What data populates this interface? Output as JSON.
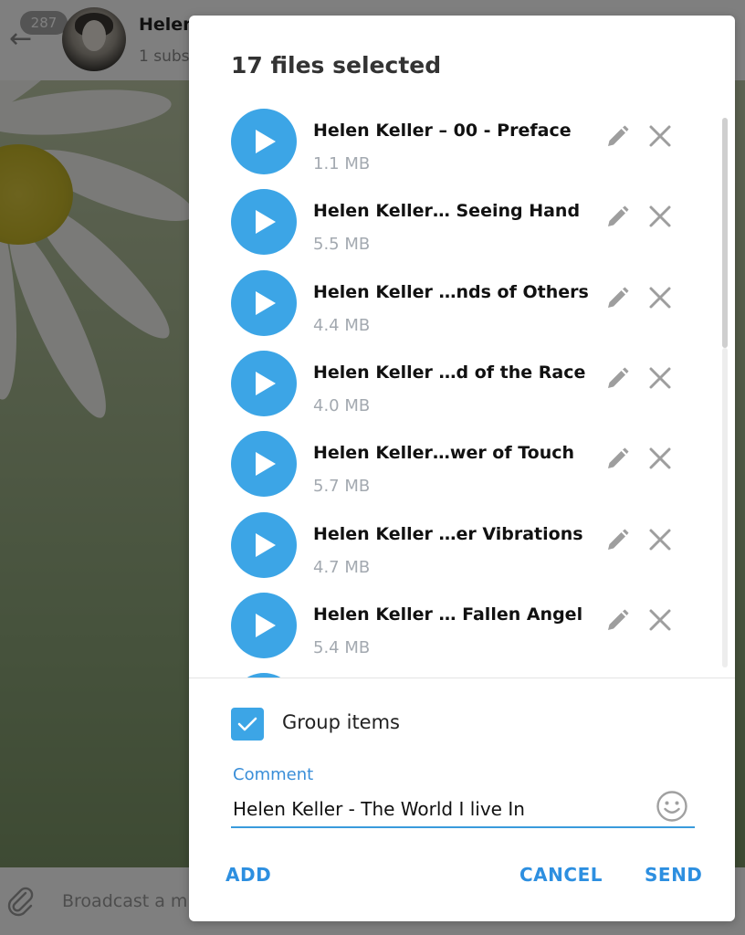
{
  "background": {
    "unread_count": "287",
    "channel_title": "Helen",
    "channel_subtitle": "1 subs",
    "message_placeholder": "Broadcast a m"
  },
  "modal": {
    "title": "17 files selected",
    "files": [
      {
        "name": "Helen Keller – 00 - Preface",
        "size": "1.1 MB"
      },
      {
        "name": "Helen Keller… Seeing Hand",
        "size": "5.5 MB"
      },
      {
        "name": "Helen Keller …nds of Others",
        "size": "4.4 MB"
      },
      {
        "name": "Helen Keller …d of the Race",
        "size": "4.0 MB"
      },
      {
        "name": "Helen Keller…wer of Touch",
        "size": "5.7 MB"
      },
      {
        "name": "Helen Keller …er Vibrations",
        "size": "4.7 MB"
      },
      {
        "name": "Helen Keller … Fallen Angel",
        "size": "5.4 MB"
      }
    ],
    "group_items": {
      "label": "Group items",
      "checked": true
    },
    "comment": {
      "label": "Comment",
      "value": "Helen Keller - The World I live In"
    },
    "buttons": {
      "add": "ADD",
      "cancel": "CANCEL",
      "send": "SEND"
    }
  },
  "icons": {
    "play": "play-icon",
    "edit": "pencil-icon",
    "remove": "close-icon",
    "emoji": "smiley-icon",
    "attach": "paperclip-icon",
    "back": "back-arrow-icon"
  },
  "colors": {
    "accent": "#3ca5e6",
    "button_text": "#2d8fe0",
    "file_size_text": "#a3a9b0"
  }
}
